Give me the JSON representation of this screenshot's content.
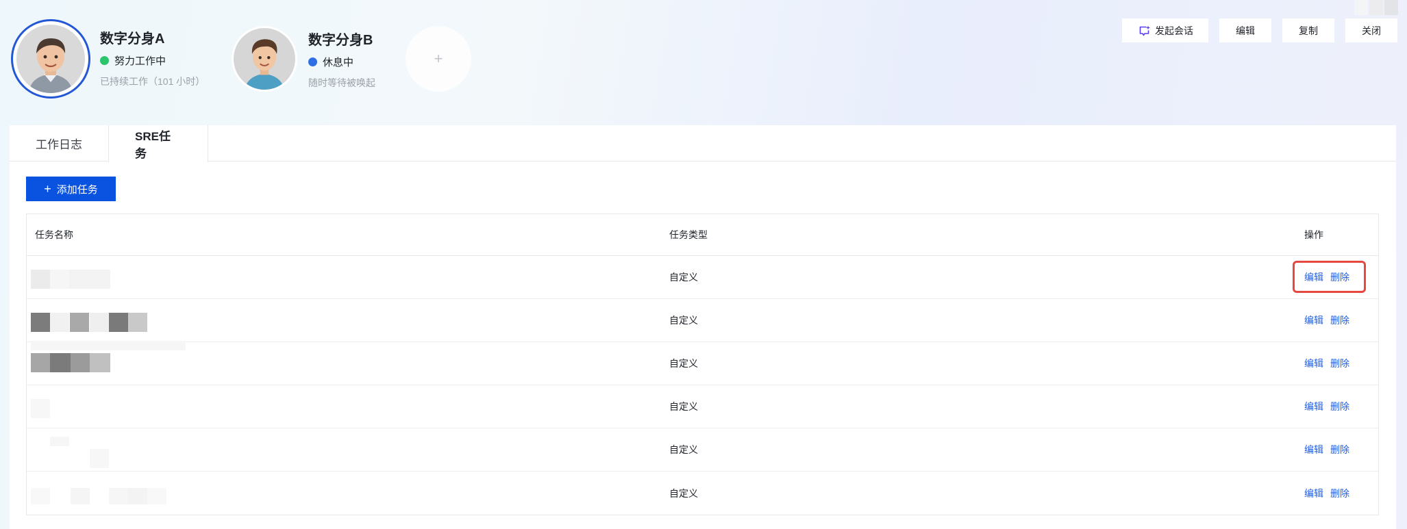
{
  "agents": [
    {
      "name": "数字分身A",
      "status": "努力工作中",
      "status_color": "#2cc56b",
      "subtitle": "已持续工作（101 小时）"
    },
    {
      "name": "数字分身B",
      "status": "休息中",
      "status_color": "#2f6fe4",
      "subtitle": "随时等待被唤起"
    }
  ],
  "add_agent": {
    "icon": "plus-icon",
    "label": "+"
  },
  "top_actions": {
    "start_chat": "发起会话",
    "edit": "编辑",
    "copy": "复制",
    "close": "关闭"
  },
  "tabs": [
    {
      "label": "工作日志",
      "active": false
    },
    {
      "label": "SRE任务",
      "active": true
    }
  ],
  "add_task_button": {
    "icon": "plus-icon",
    "label": "添加任务"
  },
  "table": {
    "columns": [
      "任务名称",
      "任务类型",
      "操作"
    ],
    "rows": [
      {
        "type": "自定义",
        "actions": [
          "编辑",
          "删除"
        ]
      },
      {
        "type": "自定义",
        "actions": [
          "编辑",
          "删除"
        ]
      },
      {
        "type": "自定义",
        "actions": [
          "编辑",
          "删除"
        ]
      },
      {
        "type": "自定义",
        "actions": [
          "编辑",
          "删除"
        ]
      },
      {
        "type": "自定义",
        "actions": [
          "编辑",
          "删除"
        ]
      },
      {
        "type": "自定义",
        "actions": [
          "编辑",
          "删除"
        ]
      }
    ]
  },
  "colors": {
    "primary": "#0a52e0",
    "link": "#1f5fe6",
    "highlight_box": "#e5483f",
    "avatar_ring": "#2457d6"
  }
}
